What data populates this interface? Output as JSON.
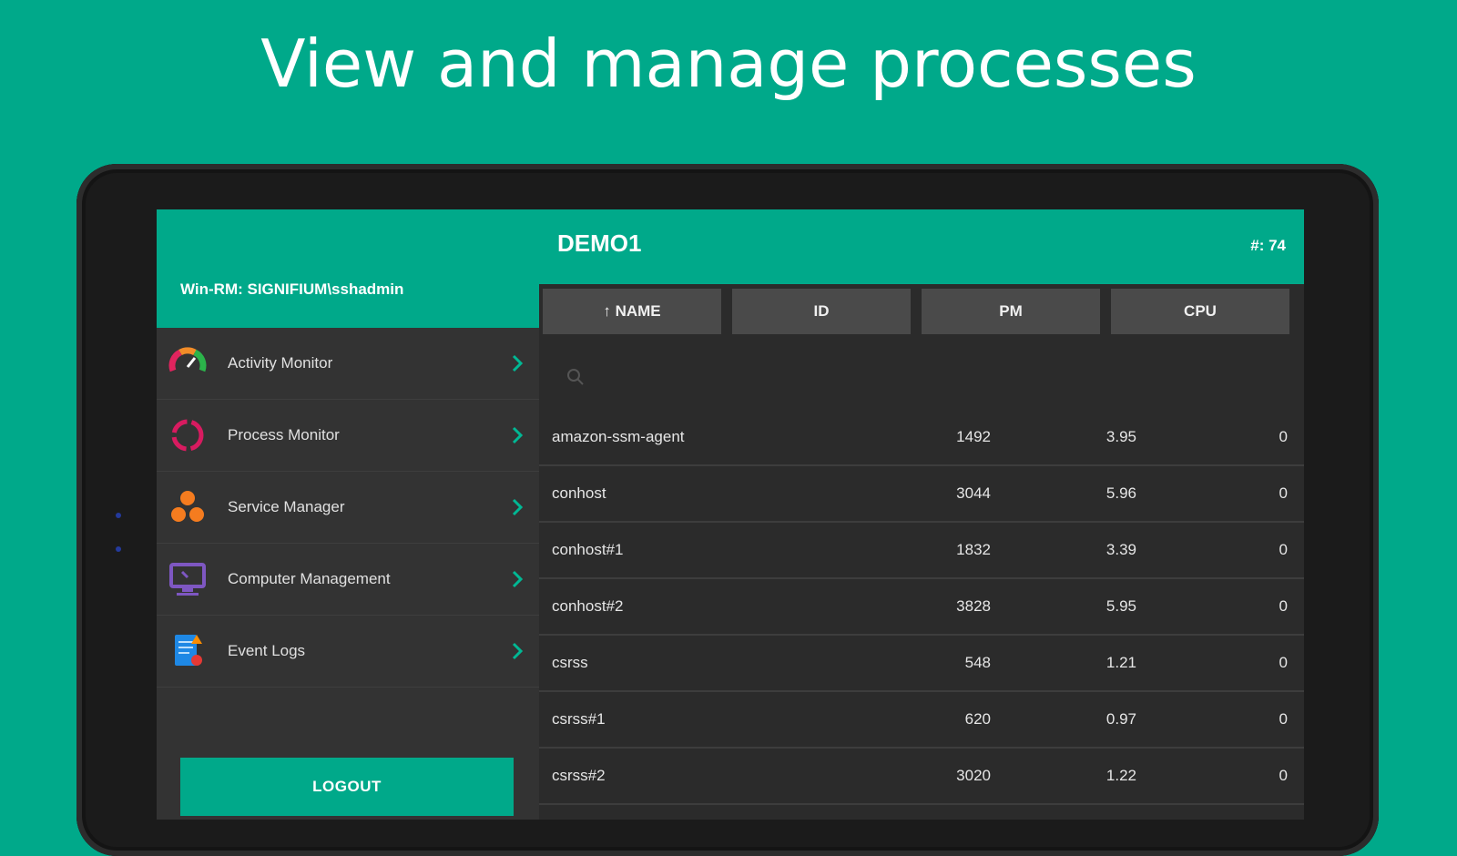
{
  "headline": "View and manage processes",
  "drawer": {
    "connection": "Win-RM: SIGNIFIUM\\sshadmin",
    "items": [
      {
        "label": "Activity Monitor"
      },
      {
        "label": "Process Monitor"
      },
      {
        "label": "Service Manager"
      },
      {
        "label": "Computer Management"
      },
      {
        "label": "Event Logs"
      }
    ],
    "logout_label": "LOGOUT"
  },
  "main": {
    "title": "DEMO1",
    "count": "#: 74",
    "sort_buttons": [
      {
        "label": "↑ NAME"
      },
      {
        "label": "ID"
      },
      {
        "label": "PM"
      },
      {
        "label": "CPU"
      }
    ],
    "search_placeholder": "",
    "rows": [
      {
        "name": "amazon-ssm-agent",
        "id": "1492",
        "pm": "3.95",
        "cpu": "0"
      },
      {
        "name": "conhost",
        "id": "3044",
        "pm": "5.96",
        "cpu": "0"
      },
      {
        "name": "conhost#1",
        "id": "1832",
        "pm": "3.39",
        "cpu": "0"
      },
      {
        "name": "conhost#2",
        "id": "3828",
        "pm": "5.95",
        "cpu": "0"
      },
      {
        "name": "csrss",
        "id": "548",
        "pm": "1.21",
        "cpu": "0"
      },
      {
        "name": "csrss#1",
        "id": "620",
        "pm": "0.97",
        "cpu": "0"
      },
      {
        "name": "csrss#2",
        "id": "3020",
        "pm": "1.22",
        "cpu": "0"
      }
    ]
  },
  "colors": {
    "accent": "#00a98a",
    "panel": "#2b2b2b",
    "button": "#4a4a4a"
  }
}
